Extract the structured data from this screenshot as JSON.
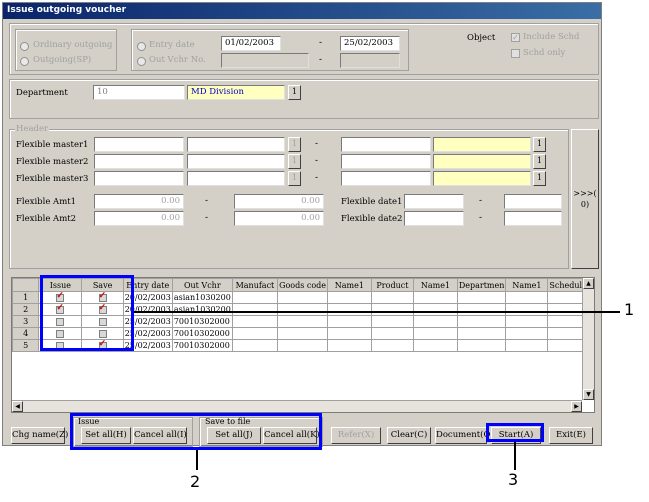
{
  "window": {
    "title": "Issue outgoing voucher"
  },
  "type_options": {
    "ordinary": "Ordinary outgoing",
    "outgoing_sp": "Outgoing(SP)"
  },
  "date_options": {
    "entry_date": "Entry date",
    "out_vchr_no": "Out Vchr No."
  },
  "entry_date": {
    "from": "01/02/2003",
    "to": "25/02/2003",
    "sep": "-"
  },
  "object": {
    "label": "Object",
    "include_schd": "Include Schd",
    "schd_only": "Schd only"
  },
  "department": {
    "label": "Department",
    "code": "10",
    "name": "MD Division",
    "lookup": "1"
  },
  "header": {
    "label": "Header",
    "flex_masters": [
      "Flexible master1",
      "Flexible master2",
      "Flexible master3"
    ],
    "flex_amts": [
      {
        "label": "Flexible Amt1",
        "from": "0.00",
        "to": "0.00"
      },
      {
        "label": "Flexible Amt2",
        "from": "0.00",
        "to": "0.00"
      }
    ],
    "flex_dates": [
      "Flexible date1",
      "Flexible date2"
    ],
    "side_button": ">>>( 0)",
    "lookup": "1"
  },
  "grid": {
    "columns": [
      "Issue",
      "Save",
      "Entry date",
      "Out Vchr",
      "Manufact",
      "Goods code",
      "Name1",
      "Product",
      "Name1",
      "Departmen",
      "Name1",
      "Scheduled"
    ],
    "rows": [
      {
        "num": "1",
        "issue": true,
        "save": true,
        "date": "20/02/2003",
        "vchr": "asian1030200"
      },
      {
        "num": "2",
        "issue": true,
        "save": true,
        "date": "20/02/2003",
        "vchr": "asian1030200"
      },
      {
        "num": "3",
        "issue": false,
        "save": false,
        "date": "25/02/2003",
        "vchr": "70010302000"
      },
      {
        "num": "4",
        "issue": false,
        "save": false,
        "date": "25/02/2003",
        "vchr": "70010302000"
      },
      {
        "num": "5",
        "issue": false,
        "save": true,
        "date": "25/02/2003",
        "vchr": "70010302000"
      }
    ]
  },
  "bottom": {
    "chg_name": "Chg name(Z)",
    "issue_label": "Issue",
    "issue_set_all": "Set all(H)",
    "issue_cancel_all": "Cancel all(I)",
    "save_label": "Save to file",
    "save_set_all": "Set all(J)",
    "save_cancel_all": "Cancel all(K)",
    "refer": "Refer(X)",
    "clear": "Clear(C)",
    "document": "Document(Q)",
    "start": "Start(A)",
    "exit": "Exit(E)"
  },
  "callouts": [
    "1",
    "2",
    "3"
  ]
}
